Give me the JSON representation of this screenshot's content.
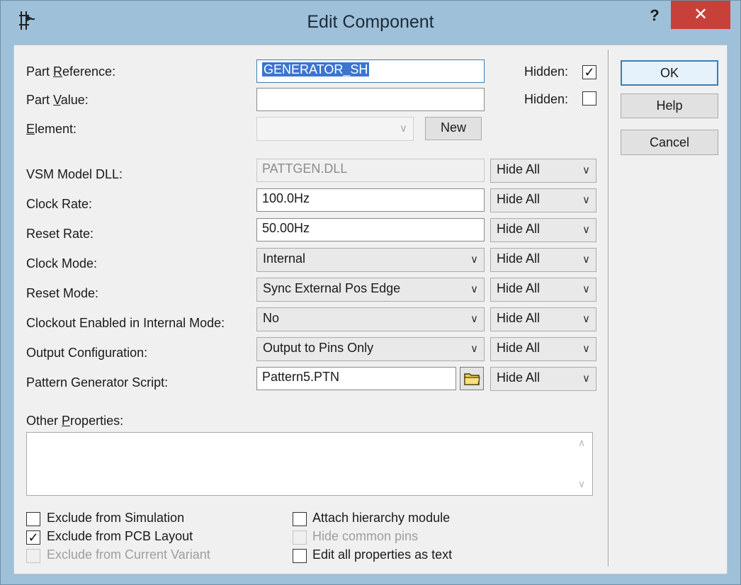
{
  "window": {
    "title": "Edit Component",
    "help_glyph": "?",
    "close_glyph": "✕"
  },
  "part_reference": {
    "label_pre": "Part ",
    "label_key": "R",
    "label_post": "eference:",
    "value": "GENERATOR_SH",
    "hidden_label": "Hidden:",
    "hidden_checked": true
  },
  "part_value": {
    "label_pre": "Part ",
    "label_key": "V",
    "label_post": "alue:",
    "value": "",
    "hidden_label": "Hidden:",
    "hidden_checked": false
  },
  "element": {
    "label_key": "E",
    "label_post": "lement:",
    "value": "",
    "new_label": "New"
  },
  "properties": [
    {
      "label": "VSM Model DLL:",
      "value": "PATTGEN.DLL",
      "kind": "text-disabled",
      "visibility": "Hide All"
    },
    {
      "label": "Clock Rate:",
      "value": "100.0Hz",
      "kind": "text",
      "visibility": "Hide All"
    },
    {
      "label": "Reset Rate:",
      "value": "50.00Hz",
      "kind": "text",
      "visibility": "Hide All"
    },
    {
      "label": "Clock Mode:",
      "value": "Internal",
      "kind": "combo",
      "visibility": "Hide All"
    },
    {
      "label": "Reset Mode:",
      "value": "Sync External Pos Edge",
      "kind": "combo",
      "visibility": "Hide All"
    },
    {
      "label": "Clockout Enabled in Internal Mode:",
      "value": "No",
      "kind": "combo",
      "visibility": "Hide All"
    },
    {
      "label": "Output Configuration:",
      "value": "Output to Pins Only",
      "kind": "combo",
      "visibility": "Hide All"
    },
    {
      "label": "Pattern Generator Script:",
      "value": "Pattern5.PTN",
      "kind": "file",
      "visibility": "Hide All"
    }
  ],
  "other_properties": {
    "label_pre": "Other ",
    "label_key": "P",
    "label_post": "roperties:",
    "value": ""
  },
  "checkboxes": {
    "exclude_simulation": {
      "label": "Exclude from Simulation",
      "checked": false,
      "enabled": true
    },
    "exclude_pcb": {
      "label": "Exclude from PCB Layout",
      "checked": true,
      "enabled": true
    },
    "exclude_variant": {
      "label": "Exclude from Current Variant",
      "checked": false,
      "enabled": false
    },
    "attach_hierarchy": {
      "label": "Attach hierarchy module",
      "checked": false,
      "enabled": true
    },
    "hide_common_pins": {
      "label": "Hide common pins",
      "checked": false,
      "enabled": false
    },
    "edit_as_text": {
      "label": "Edit all properties as text",
      "checked": false,
      "enabled": true
    }
  },
  "buttons": {
    "ok": "OK",
    "help": "Help",
    "cancel": "Cancel"
  },
  "glyphs": {
    "check": "✓",
    "dropdown": "∨",
    "scroll_up": "∧",
    "scroll_down": "∨"
  },
  "colors": {
    "titlebar": "#9ec0d9",
    "close_button": "#c7403a",
    "selection": "#3b75d0",
    "default_button_border": "#3c7fb1"
  }
}
